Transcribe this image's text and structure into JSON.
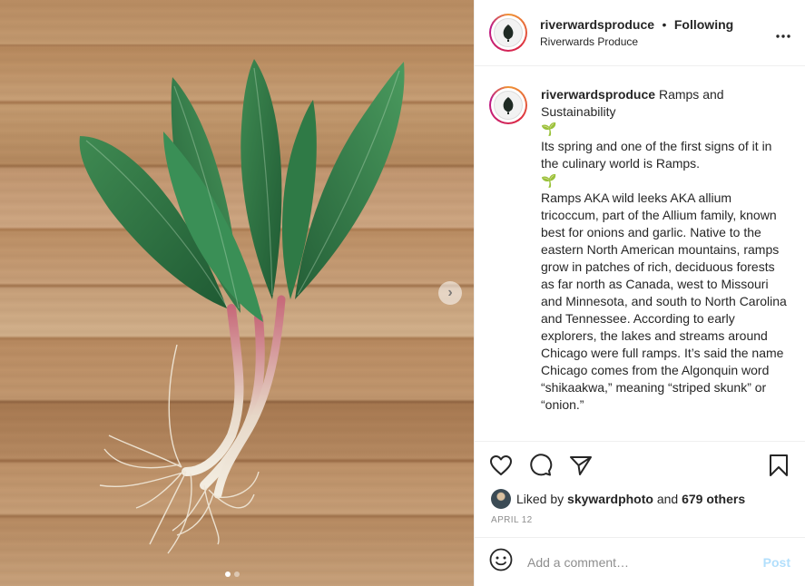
{
  "header": {
    "username": "riverwardsproduce",
    "separator": "•",
    "follow_status": "Following",
    "subtitle": "Riverwards Produce",
    "more_icon": "more-options-icon"
  },
  "caption": {
    "username": "riverwardsproduce",
    "title": "Ramps and Sustainability",
    "sprout": "🌱",
    "para1": "Its spring and one of the first signs of it in the culinary world is Ramps.",
    "para2": "Ramps AKA wild leeks AKA allium tricoccum, part of the Allium family, known best for onions and garlic. Native to the eastern North American mountains, ramps grow in patches of rich, deciduous forests as far north as Canada, west to Missouri and Minnesota, and south to North Carolina and Tennessee. According to early explorers, the lakes and streams around Chicago were full ramps. It’s said the name Chicago comes from the Algonquin word “shikaakwa,” meaning “striped skunk” or “onion.”"
  },
  "likes": {
    "prefix": "Liked by",
    "user": "skywardphoto",
    "and": "and",
    "others": "679 others"
  },
  "date": "APRIL 12",
  "comment": {
    "placeholder": "Add a comment…",
    "post_label": "Post"
  },
  "media": {
    "next_arrow": "›",
    "carousel_count": 2,
    "carousel_active": 1
  },
  "colors": {
    "post_disabled": "#b2dffc",
    "muted": "#8e8e8e"
  }
}
